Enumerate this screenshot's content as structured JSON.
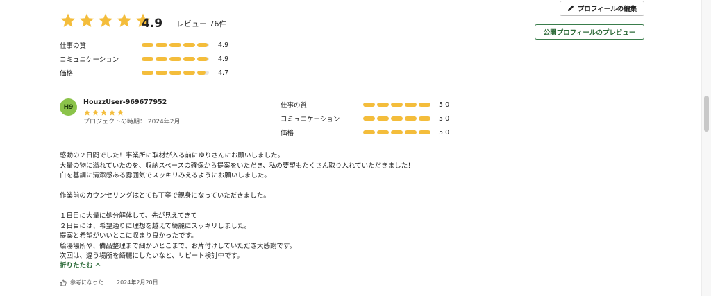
{
  "summary": {
    "rating": "4.9",
    "stars_filled": 5,
    "review_count_text": "レビュー 76件",
    "sub_ratings": [
      {
        "label": "仕事の質",
        "value": "4.9",
        "fraction": 0.98
      },
      {
        "label": "コミュニケーション",
        "value": "4.9",
        "fraction": 0.98
      },
      {
        "label": "価格",
        "value": "4.7",
        "fraction": 0.94
      }
    ]
  },
  "actions": {
    "edit_profile_label": "プロフィールの編集",
    "preview_profile_label": "公開プロフィールのプレビュー"
  },
  "review": {
    "avatar_initials": "H9",
    "avatar_color": "#8bc34a",
    "reviewer_name": "HouzzUser-969677952",
    "stars_filled": 5,
    "project_period": "プロジェクトの時期： 2024年2月",
    "sub_ratings": [
      {
        "label": "仕事の質",
        "value": "5.0",
        "fraction": 1.0
      },
      {
        "label": "コミュニケーション",
        "value": "5.0",
        "fraction": 1.0
      },
      {
        "label": "価格",
        "value": "5.0",
        "fraction": 1.0
      }
    ],
    "body_lines": [
      "感動の２日間でした！事業所に取材が入る前にゆりさんにお願いしました。",
      "大量の物に溢れていたのを、収納スペースの確保から提案をいただき、私の要望もたくさん取り入れていただきました！",
      "白を基調に清潔感ある雰囲気でスッキリみえるようにお願いしました。",
      "",
      "作業前のカウンセリングはとても丁寧で親身になっていただきました。",
      "",
      "１日目に大量に処分解体して、先が見えてきて",
      "２日目には、希望通りに理想を越えて綺麗にスッキリしました。",
      "提案と希望がいいとこに収まり良かったです。",
      "給湯場所や、備品整理まで細かいとこまで、お片付けしていただき大感謝です。",
      "次回は、違う場所を綺麗にしたいなと、リピート検討中です。"
    ],
    "collapse_label": "折りたたむ",
    "helpful_label": "参考になった",
    "date": "2024年2月20日"
  },
  "colors": {
    "star": "#f4bd3b",
    "bar_fill": "#f4bd3b",
    "bar_empty": "#e6e6e6",
    "accent_green": "#2e6b3a"
  },
  "icons": {
    "star": "star-icon",
    "pencil": "pencil-icon",
    "chevron": "chevron-up-icon",
    "thumb": "thumbs-up-icon"
  }
}
